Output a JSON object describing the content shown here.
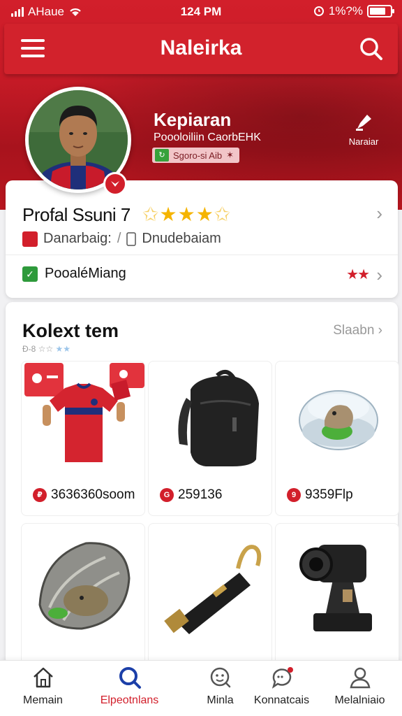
{
  "status_bar": {
    "carrier": "AHaue",
    "time": "124 PM",
    "battery": "1%?%"
  },
  "header": {
    "title": "Naleirka"
  },
  "profile": {
    "name": "Kepiaran",
    "subtitle": "Poooloiliin CaorbEHK",
    "tag": "Sgoro-si Aib",
    "action_label": "Naraiar"
  },
  "profile_card": {
    "title": "Profal Ssuni 7",
    "stars": 5,
    "info_text_1": "Danarbaig:",
    "info_text_2": "Dnudebaiam",
    "setting_label": "PooaléMiang"
  },
  "collection": {
    "title": "Kolext tem",
    "subtitle": "Đ-8",
    "see_all": "Slaabn",
    "items": [
      {
        "price": "3636360soom",
        "icon": "jersey-image"
      },
      {
        "price": "259136",
        "icon": "backpack-image"
      },
      {
        "price": "9359Flp",
        "icon": "crystal-ball-image"
      },
      {
        "price": "",
        "icon": "football-image"
      },
      {
        "price": "",
        "icon": "flashlight-image"
      },
      {
        "price": "",
        "icon": "camera-image"
      }
    ]
  },
  "tabs": [
    {
      "label": "Memain",
      "icon": "home-icon"
    },
    {
      "label": "Elpeotnlans",
      "icon": "search-icon",
      "active": true
    },
    {
      "label": "Minla",
      "icon": "smile-icon"
    },
    {
      "label": "Konnatcais",
      "icon": "chat-icon"
    },
    {
      "label": "Melalniaio",
      "icon": "user-icon"
    }
  ],
  "colors": {
    "brand": "#d21f2b",
    "active_tab": "#d21f2b"
  }
}
